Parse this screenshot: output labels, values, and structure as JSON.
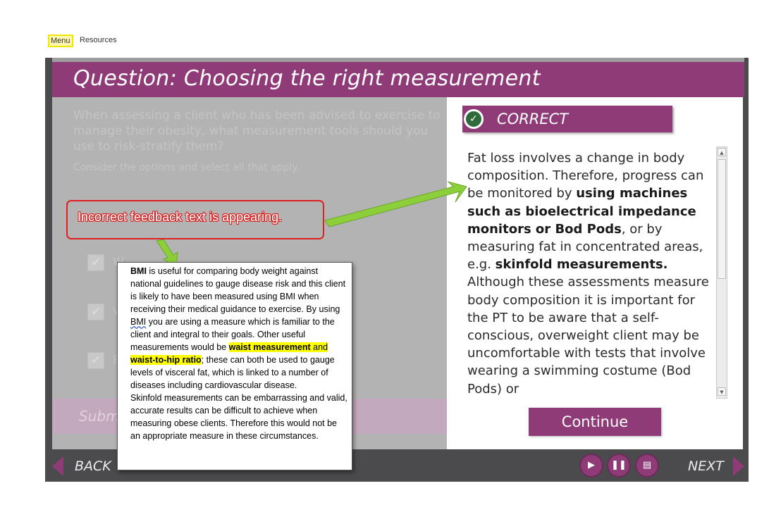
{
  "top_menu": {
    "menu": "Menu",
    "resources": "Resources"
  },
  "slide": {
    "title": "Question: Choosing the right measurement",
    "question": "When assessing a client who has been advised to exercise to manage their obesity, what measurement tools should you use to risk-stratify them?",
    "instruction": "Consider the options and select all that apply.",
    "options": [
      "W",
      "W",
      "E"
    ],
    "submit_label": "Submi"
  },
  "feedback": {
    "header": "CORRECT",
    "text_parts": [
      "Fat loss involves a change in body composition. Therefore, progress can be monitored by ",
      "using machines such as bioelectrical impedance monitors or Bod Pods",
      ", or by measuring fat in concentrated areas, e.g. ",
      "skinfold measurements.",
      " Although these assessments measure body composition it is important for the PT to be aware that a self-conscious, overweight client may be uncomfortable with tests that involve wearing a swimming costume (Bod Pods) or"
    ],
    "continue_label": "Continue"
  },
  "annotation": {
    "callout": "Incorrect feedback text is appearing."
  },
  "popup": {
    "p1_bold": "BMI",
    "p1": " is useful for comparing body weight against national guidelines to gauge disease risk and this client is likely to have been measured using BMI when receiving their medical guidance to exercise. By using ",
    "p1_bmi": "BMI",
    "p1b": " you are using a measure which is familiar to the client and integral to their goals. Other useful measurements would be ",
    "hl1": "waist measurement",
    "and": " and ",
    "hl2": "waist-to-hip ratio",
    "p1c": "; these can both be used to gauge levels of visceral fat, which is linked to a number of diseases including cardiovascular disease.",
    "p2": "Skinfold measurements can be embarrassing and valid, accurate results can be difficult to achieve when measuring obese clients. Therefore this would not be an appropriate measure in these circumstances."
  },
  "nav": {
    "back": "BACK",
    "next": "NEXT"
  },
  "colors": {
    "brand_purple": "#8e3b78",
    "frame_gray": "#4b4b4d",
    "callout_red": "#e02020",
    "arrow_green": "#8ccf3a",
    "highlight": "#ffff00"
  },
  "icons": {
    "play": "play-icon",
    "pause": "pause-icon",
    "notes": "notes-icon",
    "check": "check-icon"
  }
}
